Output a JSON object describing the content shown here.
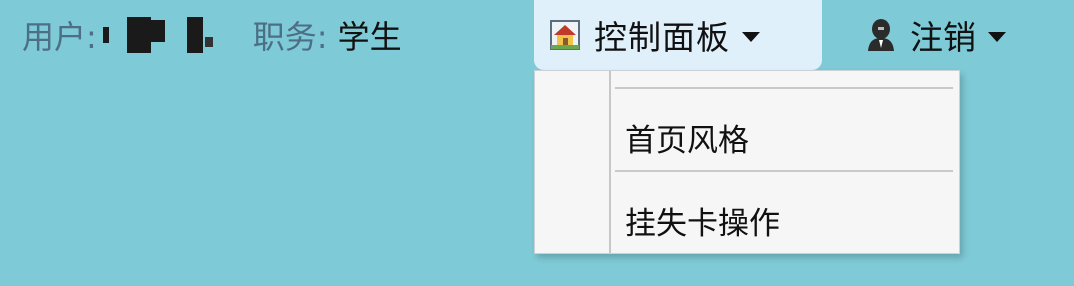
{
  "user": {
    "label": "用户:",
    "name_redacted": true
  },
  "role": {
    "label": "职务:",
    "value": "学生"
  },
  "control_panel": {
    "label": "控制面板",
    "icon": "house-icon"
  },
  "logout": {
    "label": "注销",
    "icon": "person-icon"
  },
  "dropdown": {
    "items": [
      {
        "label": "首页风格"
      },
      {
        "label": "挂失卡操作"
      }
    ]
  },
  "colors": {
    "background": "#7ecad6",
    "control_panel_bg": "#dff0fb",
    "muted_label": "#4d6f86",
    "menu_bg": "#f6f6f6"
  }
}
